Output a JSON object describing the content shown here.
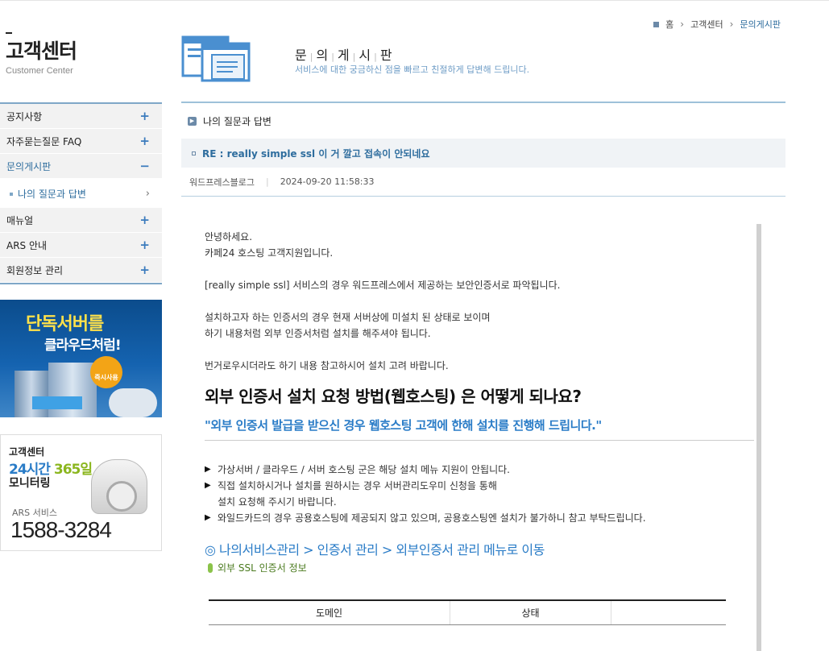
{
  "sidebar": {
    "title": "고객센터",
    "subtitle": "Customer Center",
    "menu": [
      {
        "label": "공지사항",
        "icon": "plus"
      },
      {
        "label": "자주묻는질문 FAQ",
        "icon": "plus"
      },
      {
        "label": "문의게시판",
        "icon": "minus"
      },
      {
        "label": "나의 질문과 답변",
        "icon": "chevron-right"
      },
      {
        "label": "매뉴얼",
        "icon": "plus"
      },
      {
        "label": "ARS 안내",
        "icon": "plus"
      },
      {
        "label": "회원정보 관리",
        "icon": "plus"
      }
    ],
    "banner1": {
      "line1": "단독서버를",
      "line2": "클라우드처럼!",
      "badge": "즉시사용"
    },
    "banner2": {
      "line1": "고객센터",
      "line2a": "24시간 ",
      "line2b": "365일",
      "line3": "모니터링",
      "line4": "ARS 서비스",
      "phone": "1588-3284"
    }
  },
  "breadcrumb": {
    "home": "홈",
    "level1": "고객센터",
    "current": "문의게시판"
  },
  "header": {
    "title_chars": [
      "문",
      "의",
      "게",
      "시",
      "판"
    ],
    "description": "서비스에 대한 궁금하신 점을 빠르고 친절하게 답변해 드립니다."
  },
  "board": {
    "section": "나의 질문과 답변",
    "subject": "RE : really simple ssl 이 거 깔고 접속이 안되네요",
    "author": "워드프레스블로그",
    "date": "2024-09-20 11:58:33"
  },
  "post": {
    "greeting1": "안녕하세요.",
    "greeting2": "카페24 호스팅 고객지원입니다.",
    "p1": "[really simple ssl] 서비스의 경우 워드프레스에서 제공하는 보안인증서로 파악됩니다.",
    "p2a": "설치하고자 하는 인증서의 경우 현재 서버상에 미설치 된 상태로 보이며",
    "p2b": "하기 내용처럼 외부 인증서처럼 설치를 해주셔야 됩니다.",
    "p3": "번거로우시더라도 하기 내용 참고하시어 설치 고려 바랍니다.",
    "heading": "외부 인증서 설치 요청 방법(웹호스팅) 은 어떻게 되나요?",
    "quote": "\"외부 인증서 발급을 받으신 경우 웹호스팅 고객에 한해 설치를 진행해 드립니다.\"",
    "bullets": [
      "가상서버 / 클라우드 / 서버 호스팅 군은 해당 설치 메뉴 지원이 안됩니다.",
      "직접 설치하시거나 설치를 원하시는 경우 서버관리도우미 신청을 통해",
      "와일드카드의 경우 공용호스팅에 제공되지 않고 있으며, 공용호스팅엔 설치가 불가하니 참고 부탁드립니다."
    ],
    "bullet2_cont": "설치 요청해 주시기 바랍니다.",
    "path": "◎ 나의서비스관리 > 인증서 관리 > 외부인증서 관리 메뉴로 이동",
    "ssl_info": "외부 SSL 인증서 정보",
    "table_headers": [
      "도메인",
      "상태"
    ]
  }
}
